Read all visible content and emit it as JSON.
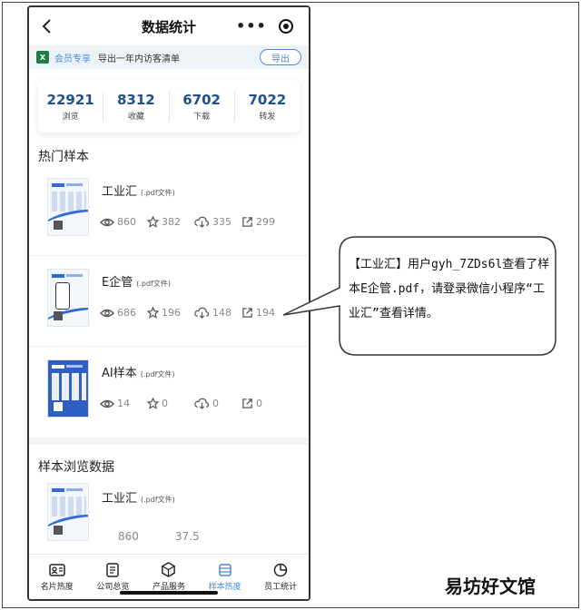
{
  "nav": {
    "title": "数据统计"
  },
  "vip_bar": {
    "icon_text": "X",
    "badge": "会员专享",
    "text": "导出一年内访客清单",
    "button": "导出"
  },
  "stats": [
    {
      "value": "22921",
      "label": "浏览"
    },
    {
      "value": "8312",
      "label": "收藏"
    },
    {
      "value": "6702",
      "label": "下载"
    },
    {
      "value": "7022",
      "label": "转发"
    }
  ],
  "hot_section": {
    "title": "热门样本"
  },
  "samples": [
    {
      "name": "工业汇",
      "ext": "(.pdf文件)",
      "views": "860",
      "stars": "382",
      "downloads": "335",
      "shares": "299"
    },
    {
      "name": "E企管",
      "ext": "(.pdf文件)",
      "views": "686",
      "stars": "196",
      "downloads": "148",
      "shares": "194"
    },
    {
      "name": "AI样本",
      "ext": "(.pdf文件)",
      "views": "14",
      "stars": "0",
      "downloads": "0",
      "shares": "0"
    }
  ],
  "browse_section": {
    "title": "样本浏览数据",
    "item": {
      "name": "工业汇",
      "ext": "(.pdf文件)",
      "partial_a": "860",
      "partial_b": "37.5"
    }
  },
  "tabbar": [
    {
      "label": "名片热度"
    },
    {
      "label": "公司总览"
    },
    {
      "label": "产品服务"
    },
    {
      "label": "样本热度"
    },
    {
      "label": "员工统计"
    }
  ],
  "callout": {
    "text": "【工业汇】用户gyh_7ZDs6l查看了样本E企管.pdf，请登录微信小程序“工业汇”查看详情。"
  },
  "watermark": "易坊好文馆",
  "colors": {
    "accent": "#4a8ad8",
    "stat_number": "#1f4f8c",
    "excel_green": "#1e7e45"
  }
}
